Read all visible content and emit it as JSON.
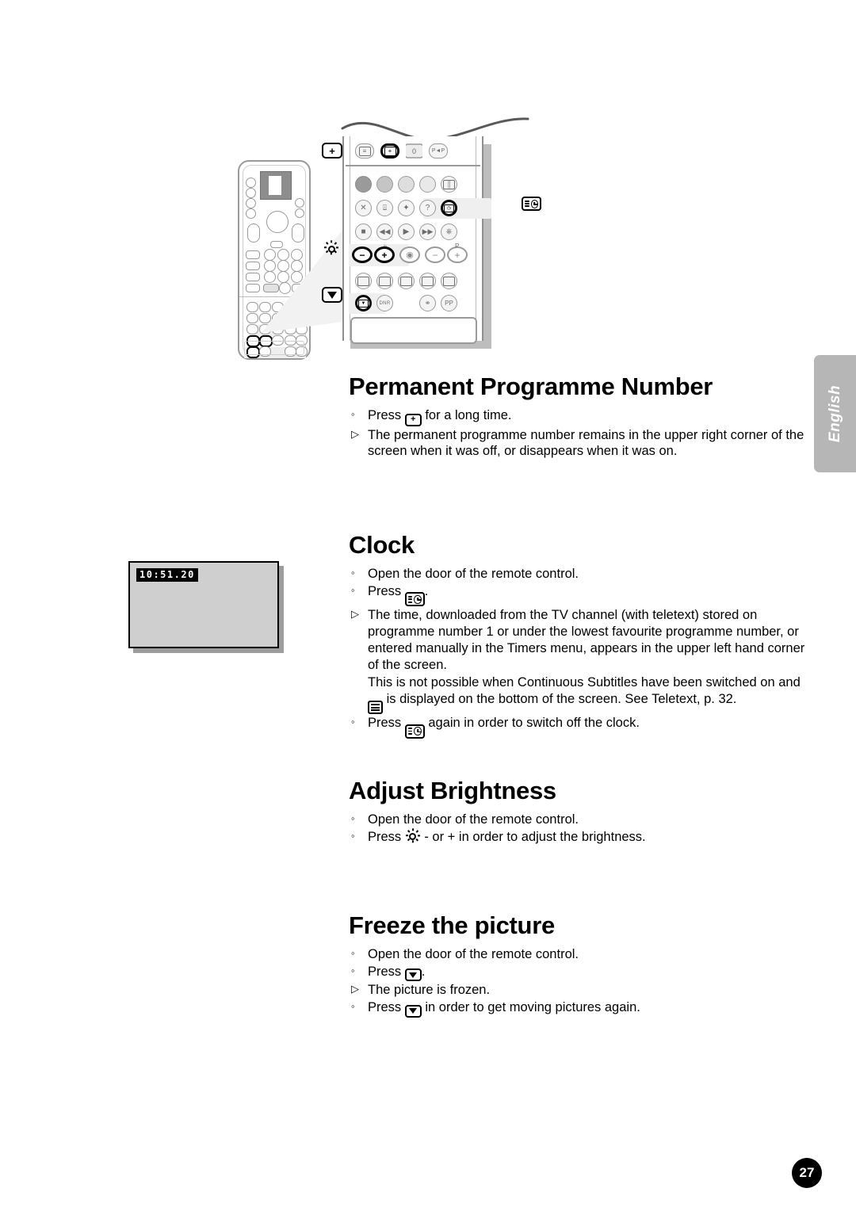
{
  "page": {
    "number": "27",
    "language_tab": "English"
  },
  "illustration": {
    "name": "remote-control-diagram",
    "callouts": [
      {
        "id": "permanent-number",
        "icon": "plus-box-icon",
        "glyph": "+"
      },
      {
        "id": "clock",
        "icon": "clock-box-icon",
        "glyph": ""
      },
      {
        "id": "brightness",
        "icon": "sun-icon",
        "glyph": ""
      },
      {
        "id": "freeze",
        "icon": "down-triangle-box-icon",
        "glyph": ""
      }
    ],
    "remote_top_row": [
      "teletext",
      "plus-box",
      "0",
      "P◄P"
    ],
    "remote_labels": {
      "dnr": "DNR",
      "pp": "PP",
      "zero": "0",
      "p_swap": "P◄P",
      "help": "?",
      "cancel": "✕",
      "p_letter": "P",
      "minus": "−",
      "plus": "+"
    }
  },
  "tv_mock": {
    "name": "tv-screen-clock-example",
    "clock_readout": "10:51.20"
  },
  "sections": [
    {
      "id": "permanent-programme-number",
      "title": "Permanent Programme Number",
      "items": [
        {
          "marker": "◦",
          "parts": [
            {
              "t": "text",
              "v": "Press "
            },
            {
              "t": "icon",
              "v": "plus-box-icon"
            },
            {
              "t": "text",
              "v": " for a long time."
            }
          ]
        },
        {
          "marker": "▷",
          "parts": [
            {
              "t": "text",
              "v": "The permanent programme number remains in the upper right corner of the screen when it was off, or disappears when it was on."
            }
          ]
        }
      ]
    },
    {
      "id": "clock",
      "title": "Clock",
      "items": [
        {
          "marker": "◦",
          "parts": [
            {
              "t": "text",
              "v": "Open the door of the remote control."
            }
          ]
        },
        {
          "marker": "◦",
          "parts": [
            {
              "t": "text",
              "v": "Press "
            },
            {
              "t": "icon",
              "v": "clock-box-icon"
            },
            {
              "t": "text",
              "v": "."
            }
          ]
        },
        {
          "marker": "▷",
          "parts": [
            {
              "t": "text",
              "v": "The time, downloaded from the TV channel (with teletext) stored on programme number 1 or under the lowest favourite programme number, or entered manually in the Timers menu, appears in the upper left hand corner of the screen."
            }
          ]
        },
        {
          "marker": "",
          "parts": [
            {
              "t": "text",
              "v": "This is not possible when Continuous Subtitles have been switched on and "
            },
            {
              "t": "icon",
              "v": "teletext-lines-icon"
            },
            {
              "t": "text",
              "v": " is displayed on the bottom of the screen. See Teletext, p. 32."
            }
          ]
        },
        {
          "marker": "◦",
          "parts": [
            {
              "t": "text",
              "v": "Press "
            },
            {
              "t": "icon",
              "v": "clock-box-icon"
            },
            {
              "t": "text",
              "v": " again in order to switch off the clock."
            }
          ]
        }
      ]
    },
    {
      "id": "adjust-brightness",
      "title": "Adjust Brightness",
      "items": [
        {
          "marker": "◦",
          "parts": [
            {
              "t": "text",
              "v": "Open the door of the remote control."
            }
          ]
        },
        {
          "marker": "◦",
          "parts": [
            {
              "t": "text",
              "v": "Press "
            },
            {
              "t": "icon",
              "v": "sun-icon"
            },
            {
              "t": "text",
              "v": " - or + in order to adjust the brightness."
            }
          ]
        }
      ]
    },
    {
      "id": "freeze-the-picture",
      "title": "Freeze the picture",
      "items": [
        {
          "marker": "◦",
          "parts": [
            {
              "t": "text",
              "v": "Open the door of the remote control."
            }
          ]
        },
        {
          "marker": "◦",
          "parts": [
            {
              "t": "text",
              "v": "Press "
            },
            {
              "t": "icon",
              "v": "down-triangle-box-icon"
            },
            {
              "t": "text",
              "v": "."
            }
          ]
        },
        {
          "marker": "▷",
          "parts": [
            {
              "t": "text",
              "v": "The picture is frozen."
            }
          ]
        },
        {
          "marker": "◦",
          "parts": [
            {
              "t": "text",
              "v": "Press "
            },
            {
              "t": "icon",
              "v": "down-triangle-box-icon"
            },
            {
              "t": "text",
              "v": " in order to get moving pictures again."
            }
          ]
        }
      ]
    }
  ],
  "section_positions": [
    0,
    200,
    510,
    680
  ]
}
